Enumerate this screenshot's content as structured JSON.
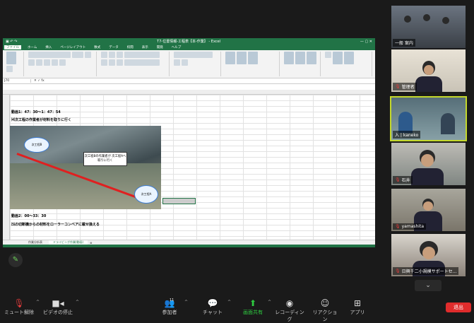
{
  "excel": {
    "title": "T7-位置情報-工程表【本-作業】 - Excel",
    "tabs": [
      "ファイル",
      "ホーム",
      "挿入",
      "ページレイアウト",
      "数式",
      "データ",
      "校閲",
      "表示",
      "開発",
      "ヘルプ"
    ],
    "cell_ref": "J70",
    "rows": {
      "line1": "動画1：47：30～1：47：54",
      "line2": "⑷次工程の作業者が材料を取りに行く",
      "line3": "動画2：00～33：30",
      "line4": "⑸の切断機からの材料をローラーコンベアに載せ換える"
    },
    "photo": {
      "bubble1": "次工程B",
      "bubble2": "次工程A",
      "callout": "次工程Bの作業者が 次工程Aへ取りに行く"
    },
    "sheet_tabs": [
      "作業分析表",
      "ドライビング作業(動画)"
    ],
    "status_left": "準備完了",
    "zoom": "100%"
  },
  "participants": [
    {
      "name": "一般 案内",
      "mic_muted": false,
      "active": false
    },
    {
      "name": "管理者",
      "mic_muted": true,
      "active": false
    },
    {
      "name": "入 | kaneko",
      "mic_muted": false,
      "active": true
    },
    {
      "name": "石井",
      "mic_muted": true,
      "active": false
    },
    {
      "name": "yamashita",
      "mic_muted": true,
      "active": false
    },
    {
      "name": "日興千二小規模サポートセ...",
      "mic_muted": true,
      "active": false
    }
  ],
  "toolbar": {
    "mute": "ミュート解除",
    "video": "ビデオの停止",
    "participants": "参加者",
    "participants_count": "11",
    "chat": "チャット",
    "share": "画面共有",
    "record": "レコーディング",
    "reactions": "リアクション",
    "apps": "アプリ",
    "end": "退出"
  }
}
